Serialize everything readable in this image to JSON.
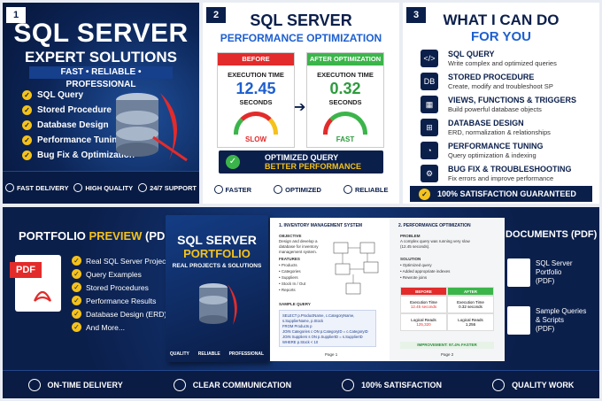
{
  "colors": {
    "navy": "#0b1f4b",
    "accent_blue": "#1d5fd0",
    "gold": "#f5c21a",
    "red": "#e32b2b",
    "green": "#3bb54a"
  },
  "panel1": {
    "number": "1",
    "title": "SQL SERVER",
    "subtitle": "EXPERT SOLUTIONS",
    "tagline": "FAST • RELIABLE • PROFESSIONAL",
    "items": [
      "SQL Query",
      "Stored Procedure",
      "Database Design",
      "Performance Tuning",
      "Bug Fix & Optimization"
    ],
    "footer": [
      "FAST DELIVERY",
      "HIGH QUALITY",
      "24/7 SUPPORT"
    ],
    "icon": "database-server-icon"
  },
  "panel2": {
    "number": "2",
    "title": "SQL SERVER",
    "subtitle": "PERFORMANCE OPTIMIZATION",
    "before": {
      "header": "BEFORE OPTIMIZATION",
      "label": "EXECUTION TIME",
      "value": "12.45",
      "unit": "SECONDS",
      "status": "SLOW"
    },
    "after": {
      "header": "AFTER OPTIMIZATION",
      "label": "EXECUTION TIME",
      "value": "0.32",
      "unit": "SECONDS",
      "status": "FAST"
    },
    "banner_line1": "OPTIMIZED QUERY",
    "banner_line2": "BETTER PERFORMANCE",
    "footer": [
      "FASTER",
      "OPTIMIZED",
      "RELIABLE"
    ]
  },
  "panel3": {
    "number": "3",
    "title": "WHAT I CAN DO",
    "subtitle": "FOR YOU",
    "services": [
      {
        "name": "SQL QUERY",
        "desc": "Write complex and optimized queries",
        "icon": "code-icon",
        "glyph": "</>"
      },
      {
        "name": "STORED PROCEDURE",
        "desc": "Create, modify and troubleshoot SP",
        "icon": "database-icon",
        "glyph": "DB"
      },
      {
        "name": "VIEWS, FUNCTIONS & TRIGGERS",
        "desc": "Build powerful database objects",
        "icon": "grid-icon",
        "glyph": "▦"
      },
      {
        "name": "DATABASE DESIGN",
        "desc": "ERD, normalization & relationships",
        "icon": "diagram-icon",
        "glyph": "⊞"
      },
      {
        "name": "PERFORMANCE TUNING",
        "desc": "Query optimization & indexing",
        "icon": "speedometer-icon",
        "glyph": "◔"
      },
      {
        "name": "BUG FIX & TROUBLESHOOTING",
        "desc": "Fix errors and improve performance",
        "icon": "gear-icon",
        "glyph": "⚙"
      }
    ],
    "guarantee": "100% SATISFACTION GUARANTEED"
  },
  "portfolio": {
    "title_a": "PORTFOLIO ",
    "title_b": "PREVIEW",
    "title_c": " (PDF)",
    "pdf_tag": "PDF",
    "items": [
      "Real SQL Server Projects",
      "Query Examples",
      "Stored Procedures",
      "Performance Results",
      "Database Design (ERD)",
      "And More..."
    ],
    "book_title": "SQL SERVER",
    "book_subtitle": "PORTFOLIO",
    "book_tagline": "REAL PROJECTS & SOLUTIONS",
    "book_footer": [
      "QUALITY",
      "RELIABLE",
      "PROFESSIONAL"
    ],
    "page1": {
      "heading": "1. INVENTORY MANAGEMENT SYSTEM",
      "objective_label": "OBJECTIVE",
      "objective": "Design and develop a database for inventory management system.",
      "features_label": "FEATURES",
      "features": [
        "• Products",
        "• Categories",
        "• Suppliers",
        "• Stock In / Out",
        "• Reports"
      ],
      "sql_label": "SAMPLE QUERY",
      "sql": [
        "SELECT p.ProductName, c.CategoryName,",
        "s.SupplierName, p.Stock",
        "FROM Products p",
        "JOIN Categories c ON p.CategoryID = c.CategoryID",
        "JOIN Suppliers s ON p.SupplierID = s.SupplierID",
        "WHERE p.Stock < 10",
        "ORDER BY p.ProductName;"
      ],
      "footer": "Page 1"
    },
    "page2": {
      "heading": "2. PERFORMANCE OPTIMIZATION",
      "problem_label": "PROBLEM",
      "problem": "A complex query was running very slow (12.45 seconds).",
      "solution_label": "SOLUTION",
      "solution": [
        "• Optimized query",
        "• Added appropriate indexes",
        "• Rewrote joins"
      ],
      "before": "BEFORE",
      "after": "AFTER",
      "exec_label": "Execution Time",
      "exec_before": "12.45 seconds",
      "exec_after": "0.32 seconds",
      "reads_label": "Logical Reads",
      "reads_before": "125,320",
      "reads_after": "1,256",
      "improvement": "IMPROVEMENT: 97.4% FASTER",
      "footer": "Page 2"
    },
    "documents_title": "DOCUMENTS (PDF)",
    "documents": [
      [
        "SQL Server",
        "Portfolio",
        "(PDF)"
      ],
      [
        "Sample Queries",
        "& Scripts",
        "(PDF)"
      ]
    ],
    "footer": [
      "ON-TIME DELIVERY",
      "CLEAR COMMUNICATION",
      "100% SATISFACTION",
      "QUALITY WORK"
    ]
  }
}
